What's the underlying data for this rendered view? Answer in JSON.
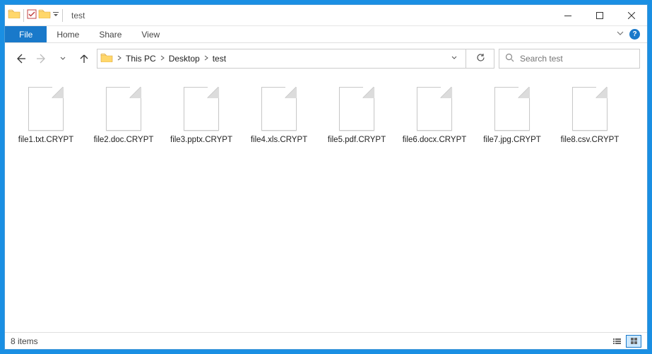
{
  "window": {
    "title": "test"
  },
  "ribbon": {
    "file": "File",
    "home": "Home",
    "share": "Share",
    "view": "View"
  },
  "breadcrumb": {
    "root": "This PC",
    "mid": "Desktop",
    "leaf": "test"
  },
  "search": {
    "placeholder": "Search test"
  },
  "files": [
    {
      "name": "file1.txt.CRYPT"
    },
    {
      "name": "file2.doc.CRYPT"
    },
    {
      "name": "file3.pptx.CRYPT"
    },
    {
      "name": "file4.xls.CRYPT"
    },
    {
      "name": "file5.pdf.CRYPT"
    },
    {
      "name": "file6.docx.CRYPT"
    },
    {
      "name": "file7.jpg.CRYPT"
    },
    {
      "name": "file8.csv.CRYPT"
    }
  ],
  "status": {
    "count_label": "8 items"
  },
  "icons": {
    "help": "?"
  }
}
